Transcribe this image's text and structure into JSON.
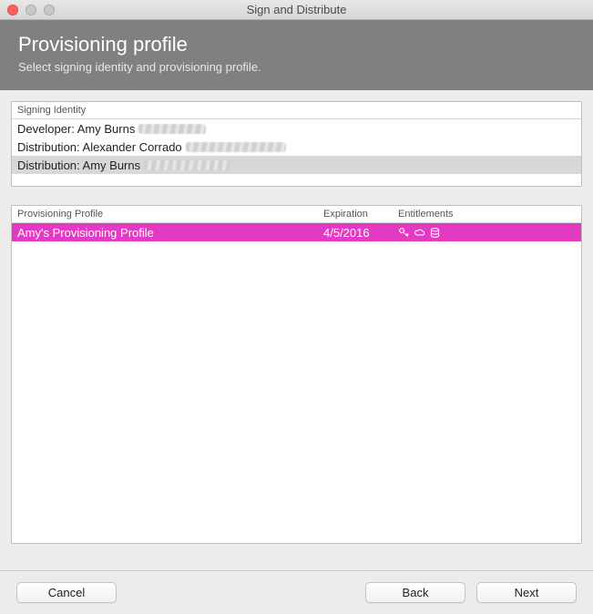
{
  "window": {
    "title": "Sign and Distribute"
  },
  "header": {
    "title": "Provisioning profile",
    "subtitle": "Select signing identity and provisioning profile."
  },
  "identity": {
    "header": "Signing Identity",
    "items": [
      {
        "label": "Developer: Amy Burns",
        "selected": false,
        "smudgeWidth": 74
      },
      {
        "label": "Distribution: Alexander Corrado",
        "selected": false,
        "smudgeWidth": 110
      },
      {
        "label": "Distribution: Amy Burns",
        "selected": true,
        "smudgeWidth": 96
      }
    ]
  },
  "profiles": {
    "headers": {
      "name": "Provisioning Profile",
      "expiration": "Expiration",
      "entitlements": "Entitlements"
    },
    "items": [
      {
        "name": "Amy's Provisioning Profile",
        "expiration": "4/5/2016",
        "selected": true
      }
    ]
  },
  "footer": {
    "cancel": "Cancel",
    "back": "Back",
    "next": "Next"
  }
}
